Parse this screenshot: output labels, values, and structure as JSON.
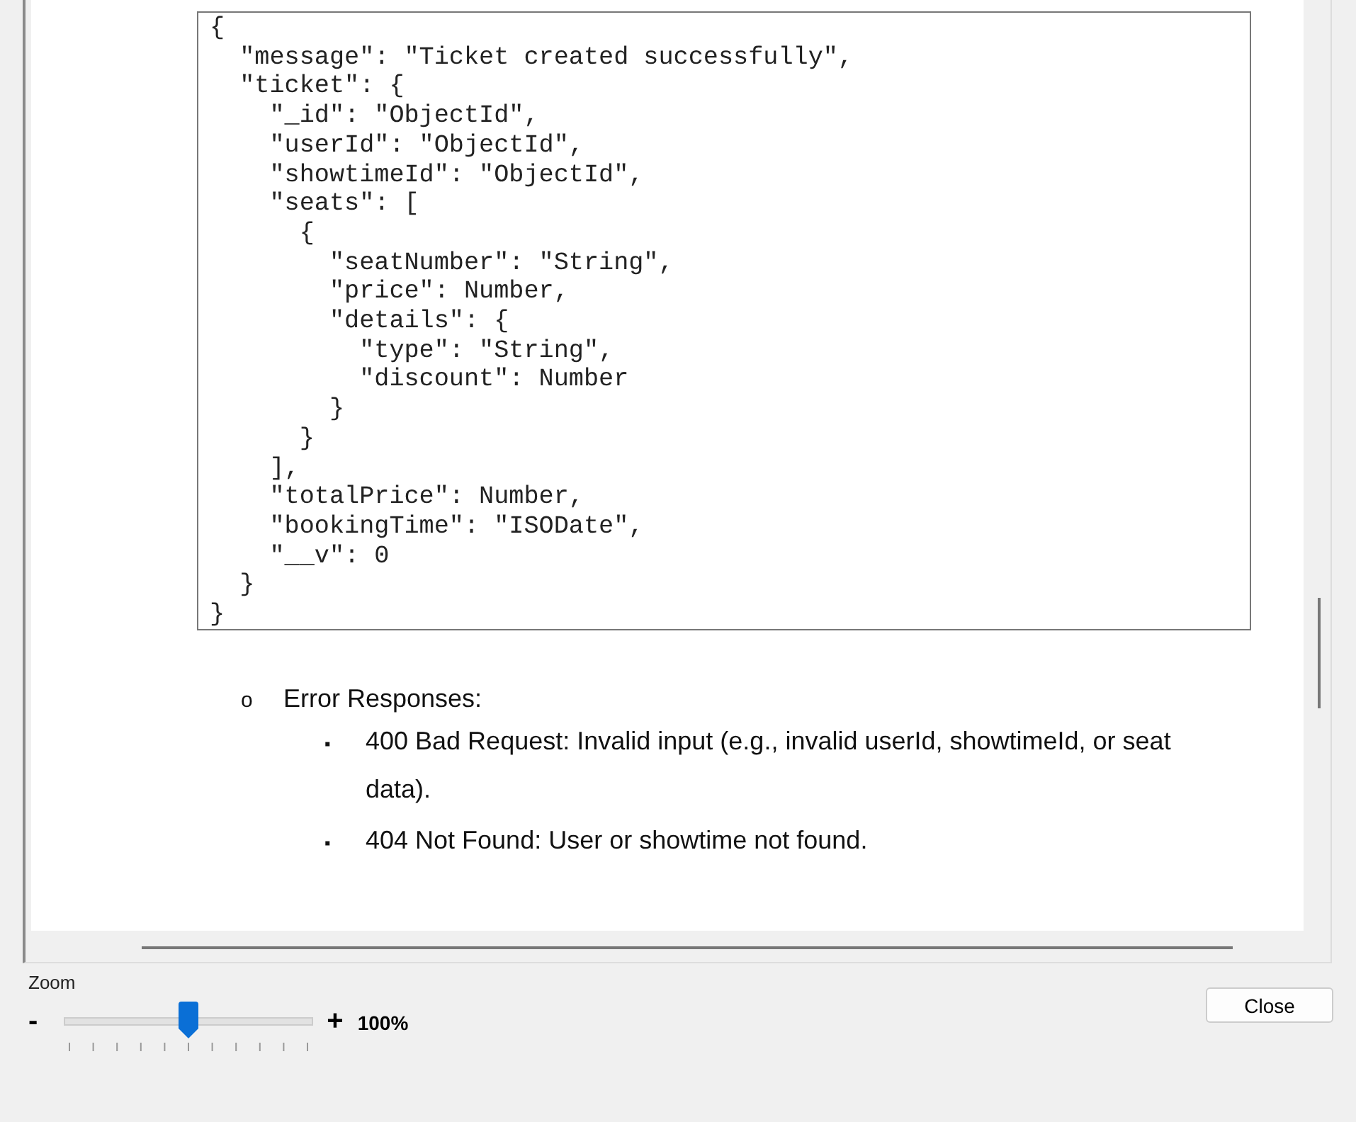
{
  "document": {
    "code_lines": [
      "{",
      "  \"message\": \"Ticket created successfully\",",
      "  \"ticket\": {",
      "    \"_id\": \"ObjectId\",",
      "    \"userId\": \"ObjectId\",",
      "    \"showtimeId\": \"ObjectId\",",
      "    \"seats\": [",
      "      {",
      "        \"seatNumber\": \"String\",",
      "        \"price\": Number,",
      "        \"details\": {",
      "          \"type\": \"String\",",
      "          \"discount\": Number",
      "        }",
      "      }",
      "    ],",
      "    \"totalPrice\": Number,",
      "    \"bookingTime\": \"ISODate\",",
      "    \"__v\": 0",
      "  }",
      "}"
    ],
    "list": {
      "marker": "o",
      "text": "Error Responses:",
      "items": [
        {
          "marker": "▪",
          "text": "400 Bad Request: Invalid input (e.g., invalid userId, showtimeId, or seat data)."
        },
        {
          "marker": "▪",
          "text": "404 Not Found: User or showtime not found."
        }
      ]
    }
  },
  "zoom": {
    "label": "Zoom",
    "minus": "-",
    "plus": "+",
    "level": 0.5,
    "reading": "100%"
  },
  "buttons": [
    "Close"
  ]
}
